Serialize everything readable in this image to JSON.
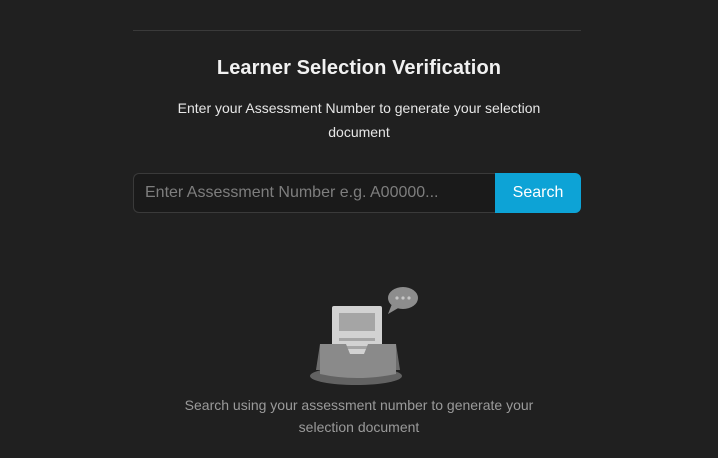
{
  "header": {
    "title": "Learner Selection Verification",
    "subtitle": "Enter your Assessment Number to generate your selection document"
  },
  "search": {
    "placeholder": "Enter Assessment Number e.g. A00000...",
    "value": "",
    "button_label": "Search"
  },
  "empty_state": {
    "message": "Search using your assessment number to generate your selection document",
    "icon": "document-inbox-icon"
  },
  "colors": {
    "background": "#202020",
    "accent": "#0da3d6",
    "muted_text": "#9a9a9a"
  }
}
